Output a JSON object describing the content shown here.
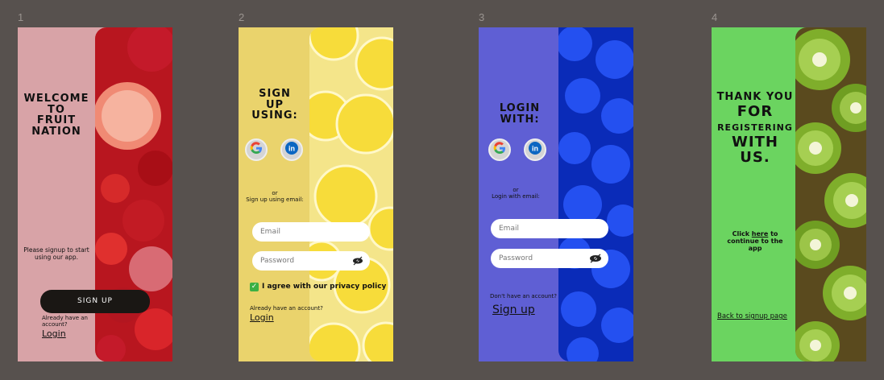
{
  "frames": [
    {
      "num": "1",
      "bg": "#d8a3a7",
      "heading": [
        "WELCOME",
        "TO",
        "FRUIT",
        "NATION"
      ],
      "subtitle": "Please signup to start using our app.",
      "button": "SIGN UP",
      "have_account": "Already have an account?",
      "login_link": "Login"
    },
    {
      "num": "2",
      "bg": "#ead36c",
      "heading": [
        "SIGN",
        "UP",
        "USING:"
      ],
      "social": [
        "google-icon",
        "linkedin-icon"
      ],
      "or": "or",
      "or_sub": "Sign up using email:",
      "email_placeholder": "Email",
      "password_placeholder": "Password",
      "agree": "I agree with our privacy policy",
      "have_account": "Already have an account?",
      "login_link": "Login"
    },
    {
      "num": "3",
      "bg": "#5f5fd4",
      "heading": [
        "LOGIN",
        "WITH:"
      ],
      "social": [
        "google-icon",
        "linkedin-icon"
      ],
      "or": "or",
      "or_sub": "Login with email:",
      "email_placeholder": "Email",
      "password_placeholder": "Password",
      "no_account": "Don't have an account?",
      "signup_link": "Sign up"
    },
    {
      "num": "4",
      "bg": "#6bd460",
      "heading": [
        "THANK YOU",
        "FOR",
        "REGISTERING",
        "WITH",
        "US."
      ],
      "click_prefix": "Click ",
      "click_link": "here",
      "click_suffix": " to continue to the app",
      "back_link": "Back to signup page"
    }
  ],
  "colors": {
    "canvas": "#57514e",
    "photo_red": "#c0202a",
    "photo_yellow": "#f2d53a",
    "photo_blue": "#1c3fe0",
    "photo_green": "#7fae2b"
  }
}
